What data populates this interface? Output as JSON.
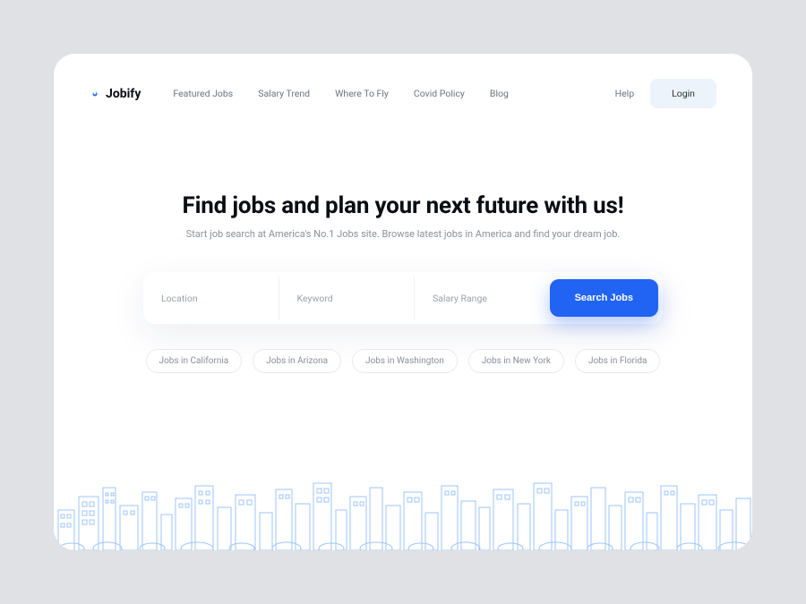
{
  "brand": {
    "name": "Jobify"
  },
  "nav": {
    "items": [
      "Featured Jobs",
      "Salary Trend",
      "Where To Fly",
      "Covid Policy",
      "Blog"
    ]
  },
  "header": {
    "help": "Help",
    "login": "Login"
  },
  "hero": {
    "title": "Find jobs and plan your next future with us!",
    "subtitle": "Start job search at America's No.1 Jobs site. Browse latest jobs in America and find your dream job."
  },
  "search": {
    "location_placeholder": "Location",
    "keyword_placeholder": "Keyword",
    "salary_placeholder": "Salary Range",
    "button": "Search Jobs"
  },
  "chips": [
    "Jobs in California",
    "Jobs in Arizona",
    "Jobs in Washington",
    "Jobs in New York",
    "Jobs in Florida"
  ]
}
